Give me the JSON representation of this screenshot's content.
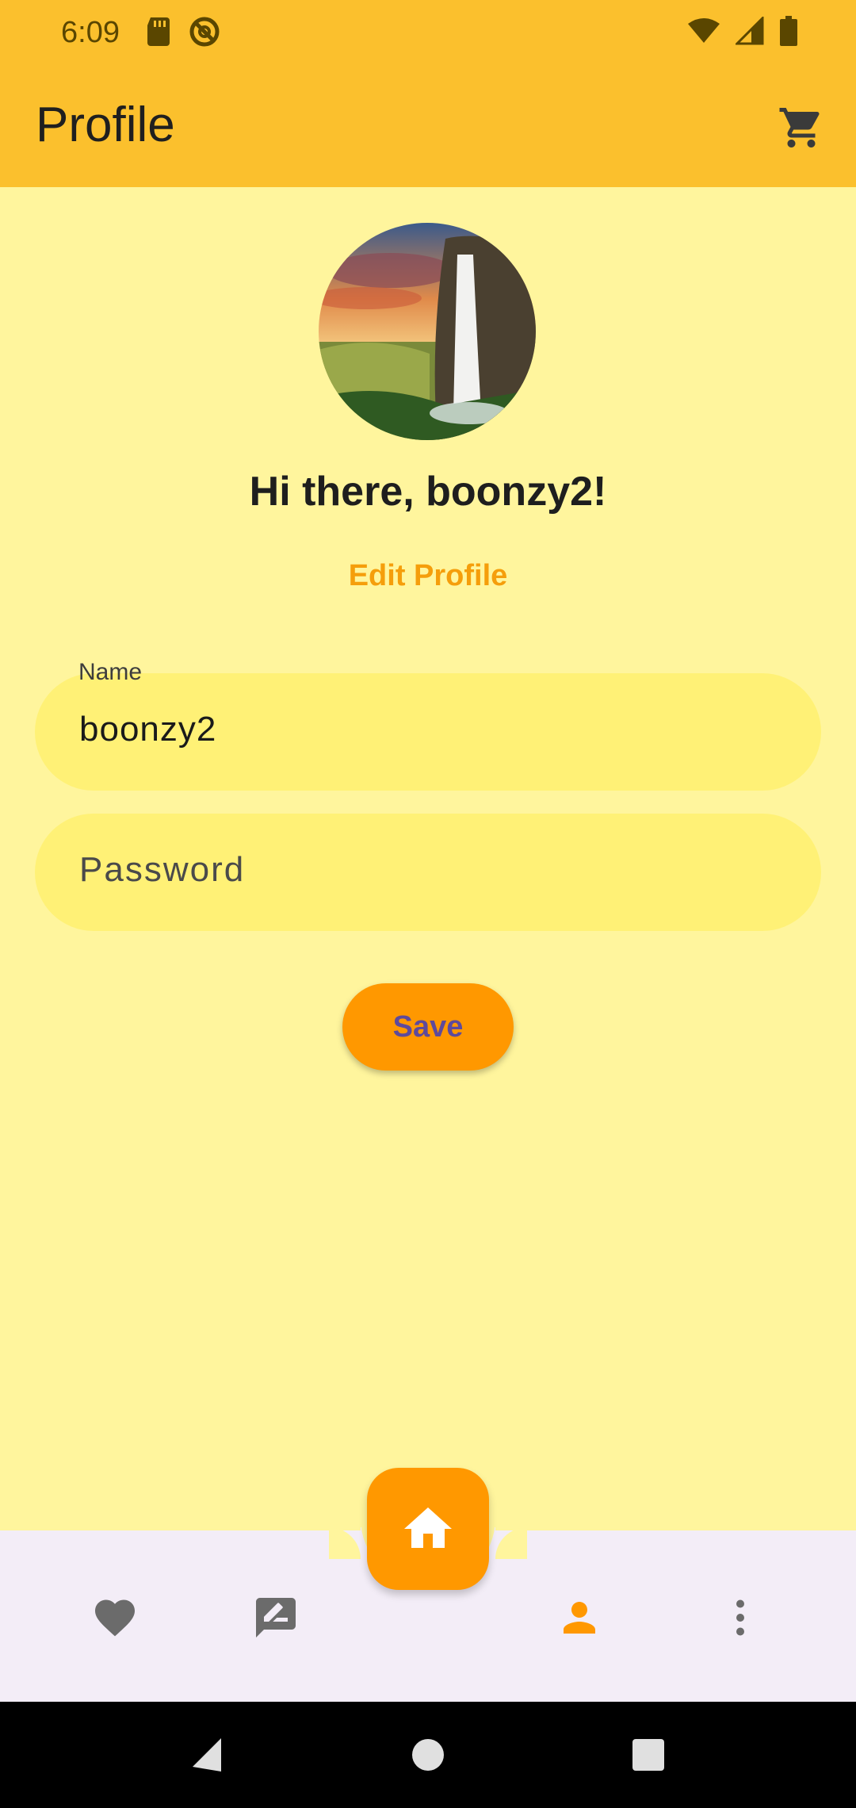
{
  "status_bar": {
    "time": "6:09",
    "left_icons": [
      "sd-card-icon",
      "no-sync-icon"
    ],
    "right_icons": [
      "wifi-icon",
      "signal-icon",
      "battery-icon"
    ]
  },
  "app_bar": {
    "title": "Profile",
    "action_icon": "cart-icon"
  },
  "profile": {
    "avatar": "waterfall-landscape-photo",
    "greeting": "Hi there, boonzy2!",
    "edit_link": "Edit Profile"
  },
  "form": {
    "name_label": "Name",
    "name_value": "boonzy2",
    "password_placeholder": "Password",
    "save_label": "Save"
  },
  "bottom_nav": {
    "items": [
      {
        "icon": "heart-icon",
        "active": false
      },
      {
        "icon": "rate-review-icon",
        "active": false
      },
      {
        "icon": "home-icon",
        "active": false
      },
      {
        "icon": "person-icon",
        "active": true
      },
      {
        "icon": "more-vert-icon",
        "active": false
      }
    ]
  },
  "colors": {
    "primary": "#FBC02D",
    "background": "#FFF59D",
    "field": "#FFF176",
    "accent": "#FF9800",
    "nav_bg": "#F3EDF7"
  }
}
